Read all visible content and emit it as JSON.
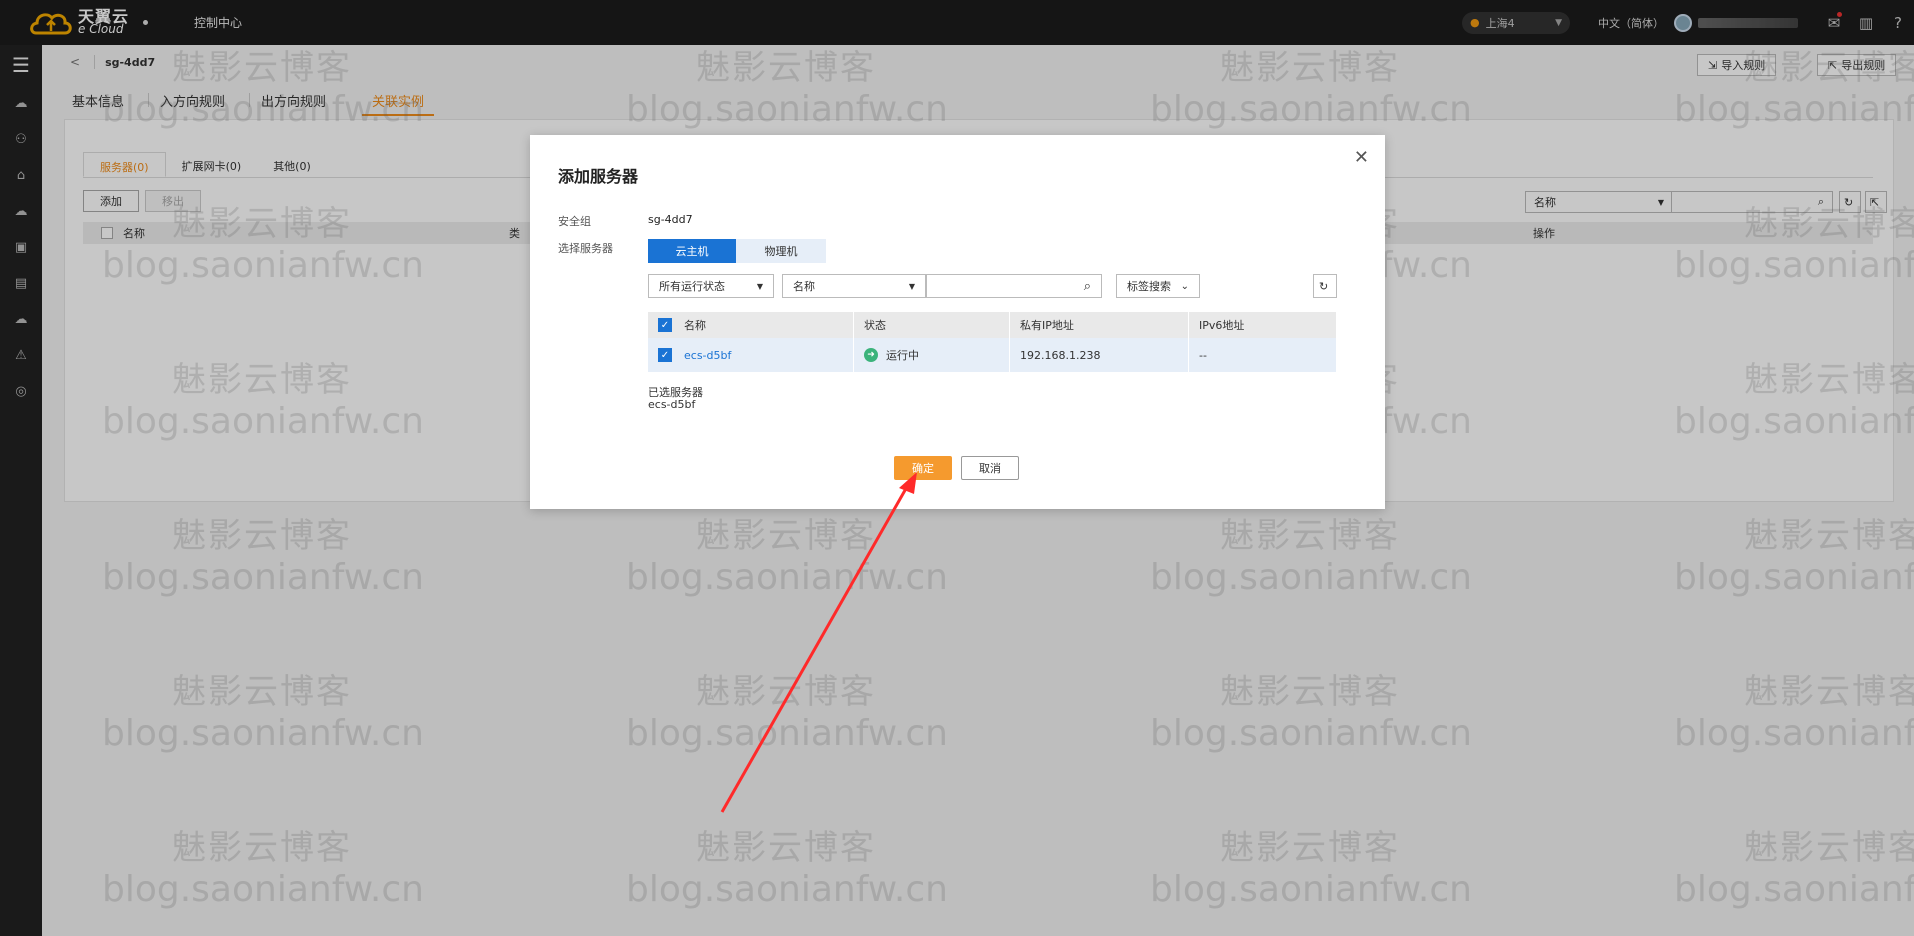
{
  "topbar": {
    "logo_cn": "天翼云",
    "logo_en": "e Cloud",
    "console": "控制中心",
    "region": "上海4",
    "language": "中文（简体）",
    "help": "?"
  },
  "page": {
    "instance_name": "sg-4dd7",
    "import_rules": "导入规则",
    "export_rules": "导出规则",
    "tabs": [
      {
        "label": "基本信息"
      },
      {
        "label": "入方向规则"
      },
      {
        "label": "出方向规则"
      },
      {
        "label": "关联实例"
      }
    ],
    "subtabs": [
      {
        "label": "服务器(0)"
      },
      {
        "label": "扩展网卡(0)"
      },
      {
        "label": "其他(0)"
      }
    ],
    "add_button": "添加",
    "remove_button": "移出",
    "filter_name": "名称",
    "table_headers": {
      "name": "名称",
      "type": "类",
      "action": "操作"
    }
  },
  "modal": {
    "title": "添加服务器",
    "security_group_label": "安全组",
    "security_group_value": "sg-4dd7",
    "select_server_label": "选择服务器",
    "seg_vm": "云主机",
    "seg_physical": "物理机",
    "status_filter": "所有运行状态",
    "name_filter": "名称",
    "tag_search": "标签搜索",
    "columns": [
      "名称",
      "状态",
      "私有IP地址",
      "IPv6地址"
    ],
    "rows": [
      {
        "name": "ecs-d5bf",
        "status": "运行中",
        "private_ip": "192.168.1.238",
        "ipv6": "--"
      }
    ],
    "selected_label": "已选服务器",
    "selected_value": "ecs-d5bf",
    "confirm": "确定",
    "cancel": "取消"
  },
  "watermark": {
    "cn": "魅影云博客",
    "en": "blog.saonianfw.cn"
  },
  "colors": {
    "accent_orange": "#f59a2e",
    "primary_blue": "#1a73d4",
    "arrow_red": "#ff2a2a"
  }
}
